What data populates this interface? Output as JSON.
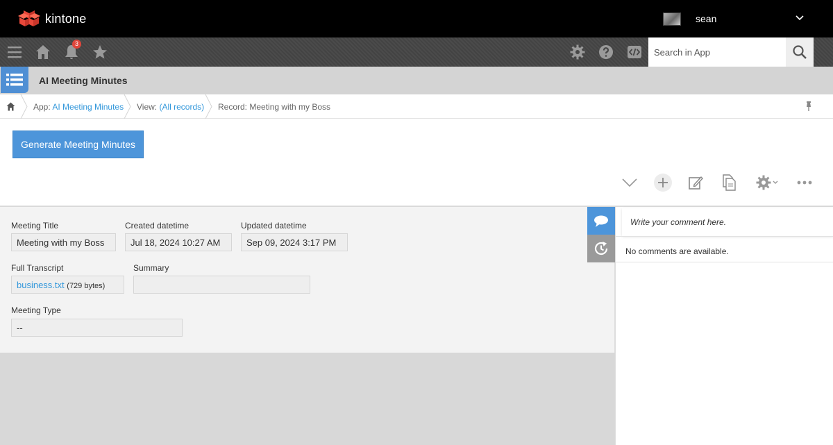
{
  "brand": {
    "name": "kintone",
    "logo_icon": "kintone-logo-icon"
  },
  "user": {
    "name": "sean"
  },
  "nav": {
    "notification_count": "3",
    "search_placeholder": "Search in App"
  },
  "app": {
    "title": "AI Meeting Minutes"
  },
  "breadcrumb": {
    "app_prefix": "App: ",
    "app_name": "AI Meeting Minutes",
    "view_prefix": "View: ",
    "view_name": "(All records)",
    "record_text": "Record: Meeting with my Boss"
  },
  "actions": {
    "generate_label": "Generate Meeting Minutes"
  },
  "record": {
    "meeting_title": {
      "label": "Meeting Title",
      "value": "Meeting with my Boss"
    },
    "created": {
      "label": "Created datetime",
      "value": "Jul 18, 2024 10:27 AM"
    },
    "updated": {
      "label": "Updated datetime",
      "value": "Sep 09, 2024 3:17 PM"
    },
    "transcript": {
      "label": "Full Transcript",
      "file_name": "business.txt",
      "file_size": "(729 bytes)"
    },
    "summary": {
      "label": "Summary",
      "value": ""
    },
    "meeting_type": {
      "label": "Meeting Type",
      "value": "--"
    }
  },
  "comments": {
    "placeholder": "Write your comment here.",
    "empty_text": "No comments are available."
  },
  "colors": {
    "accent": "#4d95da",
    "link": "#3498db",
    "badge": "#e0463c",
    "topbar": "#000000"
  }
}
